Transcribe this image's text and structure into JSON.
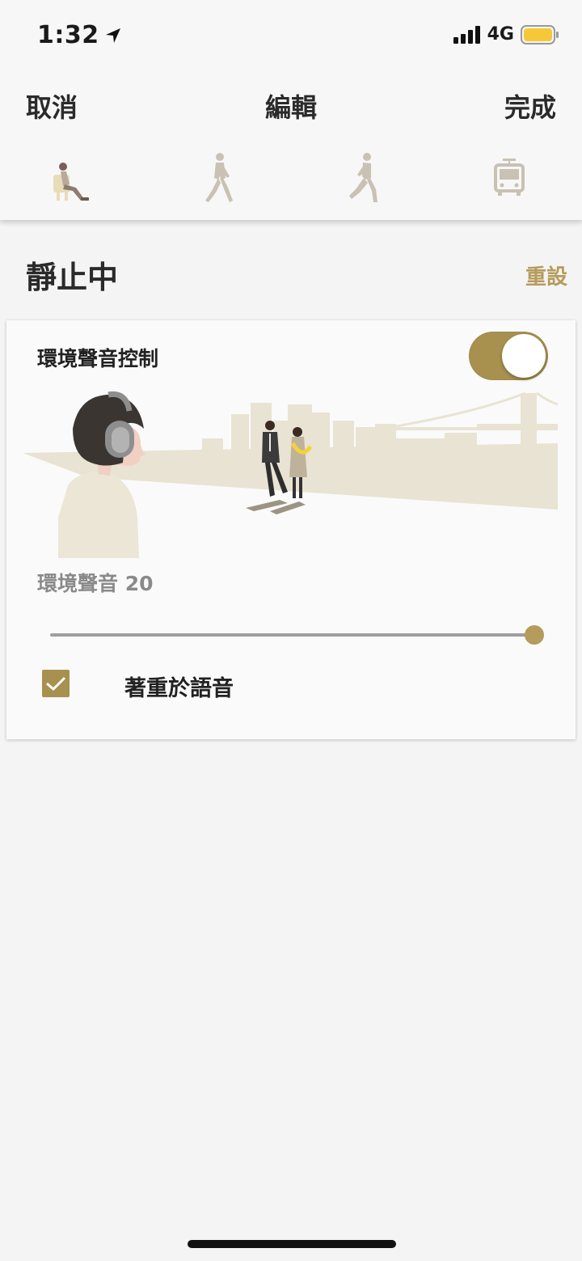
{
  "status_bar": {
    "time": "1:32",
    "network": "4G",
    "battery_color": "#f5c83a"
  },
  "nav": {
    "cancel_label": "取消",
    "title": "編輯",
    "done_label": "完成"
  },
  "mode_tabs": [
    {
      "icon": "sitting-person-icon",
      "selected": true
    },
    {
      "icon": "walking-person-icon",
      "selected": false
    },
    {
      "icon": "running-person-icon",
      "selected": false
    },
    {
      "icon": "train-icon",
      "selected": false
    }
  ],
  "section": {
    "title": "靜止中",
    "reset_label": "重設"
  },
  "card": {
    "control_label": "環境聲音控制",
    "toggle_on": true,
    "ambient_label": "環境聲音 20",
    "slider_level_percent": 100,
    "voice_focus_label": "著重於語音",
    "voice_focus_checked": true
  },
  "colors": {
    "accent": "#a8904f",
    "accent_light": "#b59b5c",
    "background": "#f4f4f4",
    "card": "#fafafa",
    "illustration_tan": "#e9e3d4"
  }
}
